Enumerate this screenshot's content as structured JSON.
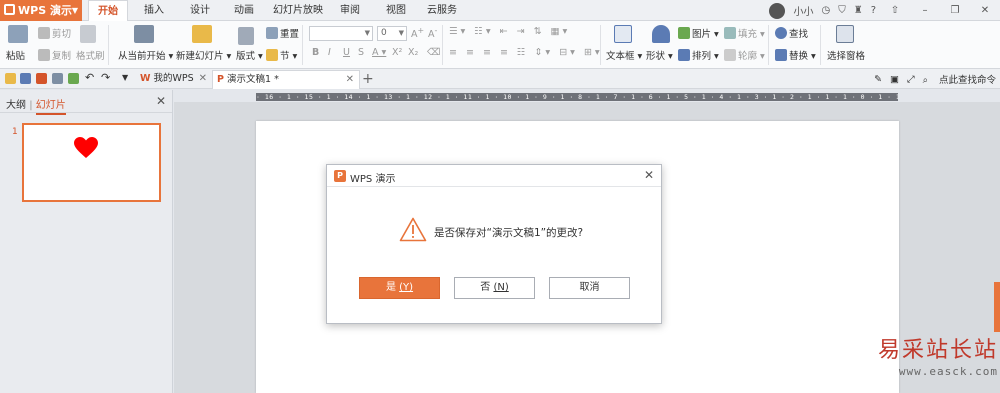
{
  "app": {
    "name": "WPS 演示"
  },
  "menu": {
    "tabs": [
      "开始",
      "插入",
      "设计",
      "动画",
      "幻灯片放映",
      "审阅",
      "视图",
      "云服务"
    ],
    "active": "开始"
  },
  "user": {
    "name": "小小"
  },
  "ribbon": {
    "paste": "粘贴",
    "cut": "剪切",
    "copy": "复制",
    "format_painter": "格式刷",
    "from_current": "从当前开始",
    "new_slide": "新建幻灯片",
    "layout": "版式",
    "reset": "重置",
    "section": "节",
    "font_size": "0",
    "text_box": "文本框",
    "shape": "形状",
    "picture": "图片",
    "fill": "填充",
    "arrange": "排列",
    "outline": "轮廓",
    "find": "查找",
    "replace": "替换",
    "selection_pane": "选择窗格"
  },
  "tabbar": {
    "my_wps": "我的WPS",
    "doc_tab": "演示文稿1 *",
    "command_search": "点此查找命令"
  },
  "left_panel": {
    "tab_outline": "大纲",
    "tab_slides": "幻灯片",
    "slide_number": "1"
  },
  "ruler": {
    "text": "· 16 · 1 · 15 · 1 · 14 · 1 · 13 · 1 · 12 · 1 · 11 · 1 · 10 · 1 · 9 · 1 · 8 · 1 · 7 · 1 · 6 · 1 · 5 · 1 · 4 · 1 · 3 · 1 · 2 · 1 · 1 · 1 · 0 · 1 · 1 · 1 · 2 · 1 · 3 · 1 · 4 · 1 · 5 · 1 · 6 · 1 · 7 · 1 · 8 · 1 · 9 · 1 · 10 · 1 · 11 · 1 · 12 · 1 · 13 · 1 · 14 · 1 · 15 · 1 · 16 ·"
  },
  "dialog": {
    "title": "WPS 演示",
    "message": "是否保存对“演示文稿1”的更改?",
    "yes": "是",
    "yes_key": "(Y)",
    "no": "否",
    "no_key": "(N)",
    "cancel": "取消"
  },
  "watermark": {
    "cn": "易采站长站",
    "url": "www.easck.com"
  },
  "colors": {
    "accent": "#e8743b",
    "heart": "#ff0000"
  }
}
